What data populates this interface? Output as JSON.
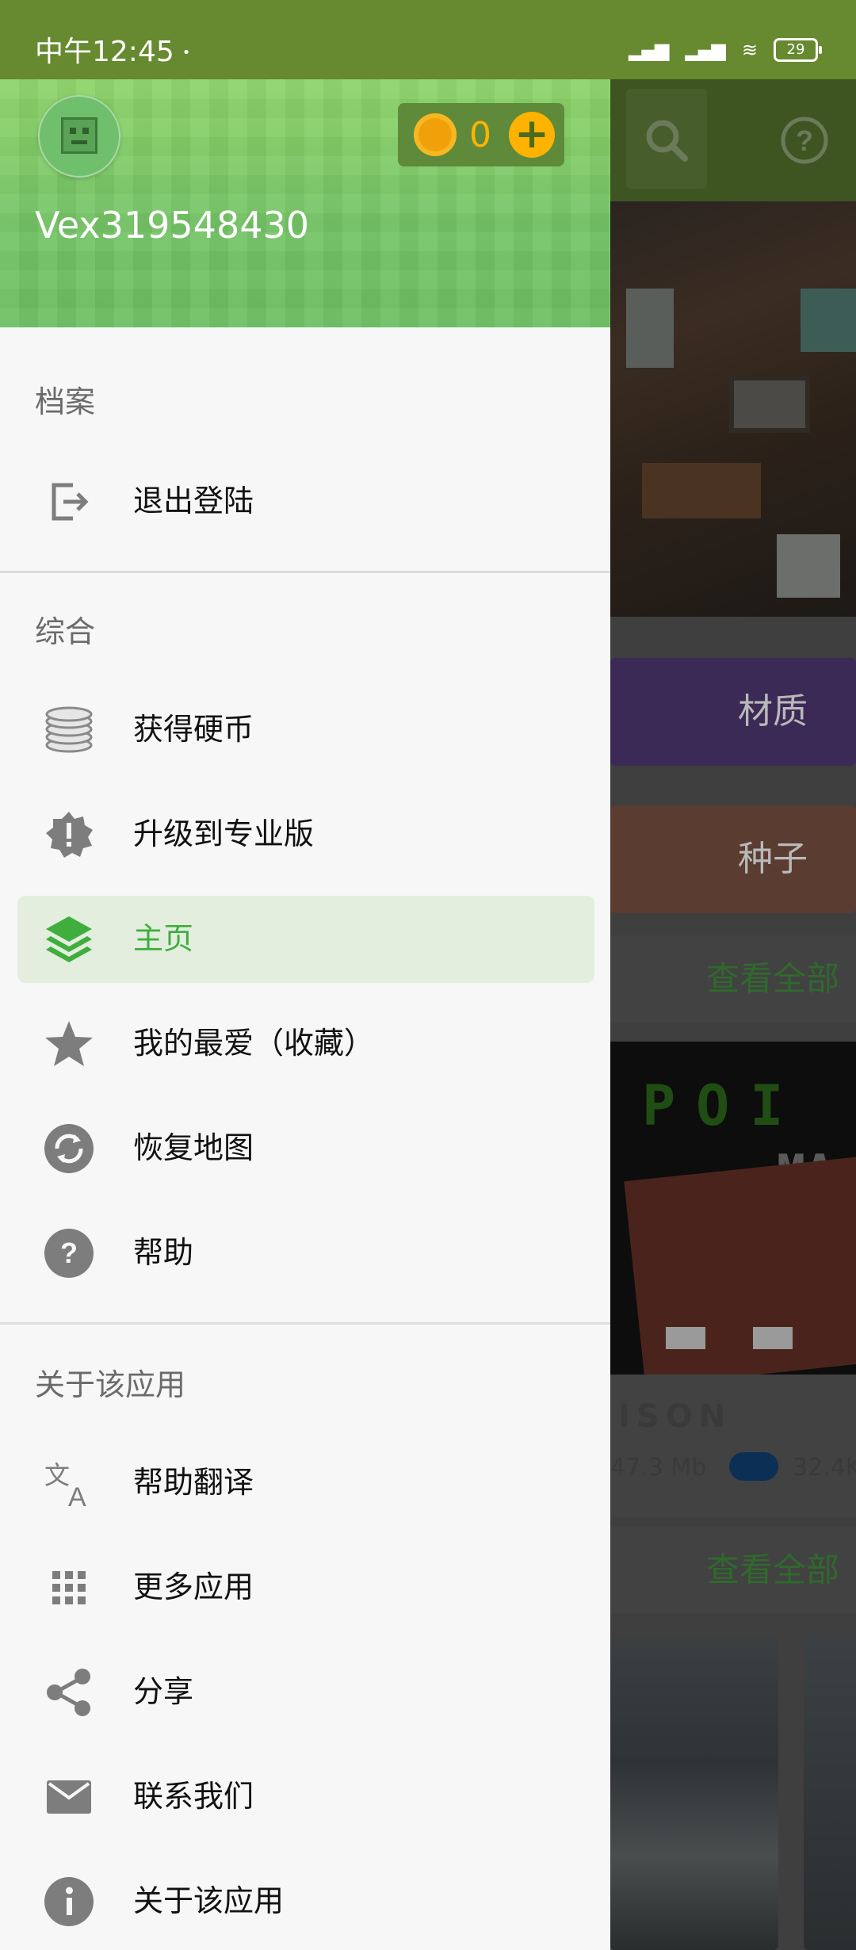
{
  "status_bar": {
    "time": "中午12:45",
    "battery": "29"
  },
  "drawer": {
    "username": "Vex319548430",
    "coins": "0",
    "coin_add": "+",
    "sections": [
      {
        "title": "档案",
        "items": [
          {
            "label": "退出登陆",
            "icon": "logout-icon"
          }
        ]
      },
      {
        "title": "综合",
        "items": [
          {
            "label": "获得硬币",
            "icon": "coins-icon"
          },
          {
            "label": "升级到专业版",
            "icon": "premium-badge-icon"
          },
          {
            "label": "主页",
            "icon": "layers-icon",
            "active": true
          },
          {
            "label": "我的最爱（收藏）",
            "icon": "star-icon"
          },
          {
            "label": "恢复地图",
            "icon": "sync-icon"
          },
          {
            "label": "帮助",
            "icon": "help-icon"
          }
        ]
      },
      {
        "title": "关于该应用",
        "items": [
          {
            "label": "帮助翻译",
            "icon": "translate-icon"
          },
          {
            "label": "更多应用",
            "icon": "apps-grid-icon"
          },
          {
            "label": "分享",
            "icon": "share-icon"
          },
          {
            "label": "联系我们",
            "icon": "mail-icon"
          },
          {
            "label": "关于该应用",
            "icon": "info-icon"
          }
        ]
      }
    ]
  },
  "background": {
    "category_1": "材质",
    "category_2": "种子",
    "see_all_1": "查看全部",
    "card_title": "ISON",
    "card_size": "47.3 Mb",
    "card_downloads": "32.4K",
    "see_all_2": "查看全部"
  },
  "colors": {
    "accent": "#3fae3d",
    "header_green": "#74c466",
    "status_bar": "#67892f",
    "coin": "#ffb300",
    "active_item_bg": "#e3eedf"
  }
}
